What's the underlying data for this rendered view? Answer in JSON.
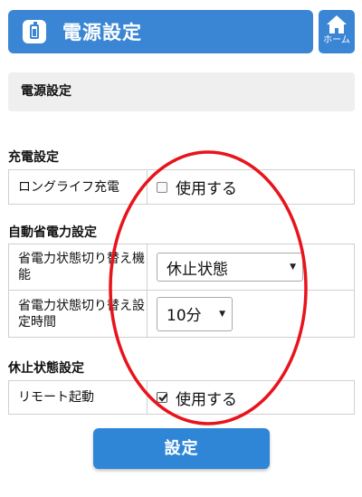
{
  "header": {
    "title": "電源設定",
    "icon": "battery-icon"
  },
  "home": {
    "label": "ホーム",
    "icon": "home-icon"
  },
  "page_subtitle": "電源設定",
  "sections": {
    "charge": {
      "heading": "充電設定",
      "rows": [
        {
          "label": "ロングライフ充電",
          "control": "checkbox",
          "checked": false,
          "option_label": "使用する"
        }
      ]
    },
    "auto_power_save": {
      "heading": "自動省電力設定",
      "rows": [
        {
          "label": "省電力状態切り替え機能",
          "control": "select",
          "value": "休止状態"
        },
        {
          "label": "省電力状態切り替え設定時間",
          "control": "select",
          "value": "10分"
        }
      ]
    },
    "sleep": {
      "heading": "休止状態設定",
      "rows": [
        {
          "label": "リモート起動",
          "control": "checkbox",
          "checked": true,
          "option_label": "使用する"
        }
      ]
    }
  },
  "submit": {
    "label": "設定"
  },
  "colors": {
    "accent": "#3a86d4",
    "annotation": "#e8141b",
    "subtitle_bg": "#efefef"
  }
}
